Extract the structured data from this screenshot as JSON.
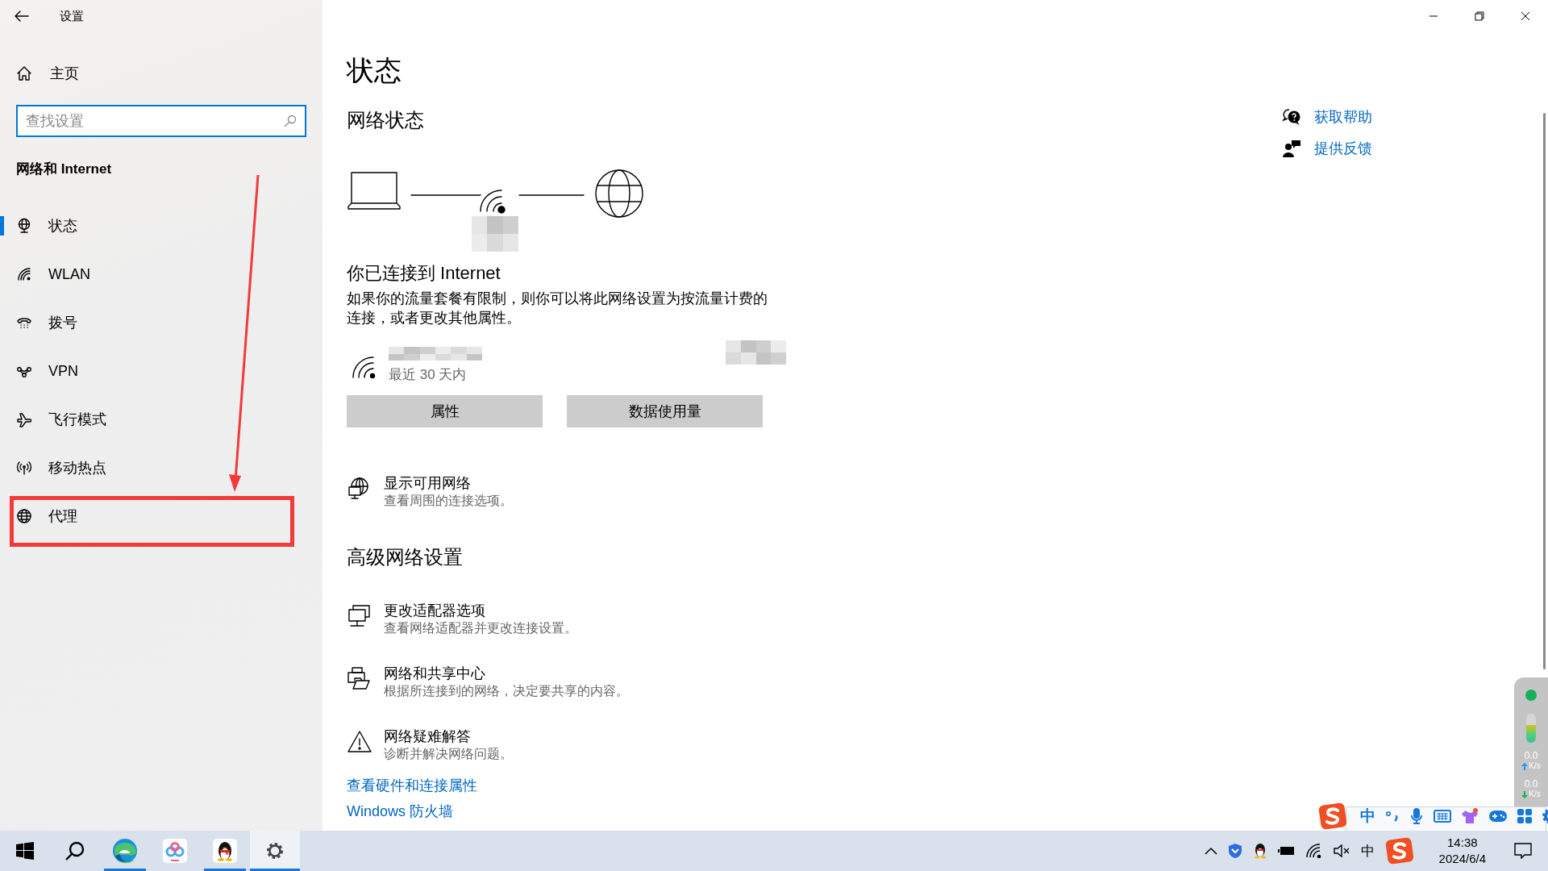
{
  "window": {
    "title": "设置"
  },
  "sidebar": {
    "home": "主页",
    "search": {
      "placeholder": "查找设置",
      "focused": true
    },
    "section": "网络和 Internet",
    "items": [
      {
        "kind": "status",
        "label": "状态",
        "selected": true,
        "highlighted": false
      },
      {
        "kind": "wlan",
        "label": "WLAN",
        "selected": false,
        "highlighted": false
      },
      {
        "kind": "dialup",
        "label": "拨号",
        "selected": false,
        "highlighted": false
      },
      {
        "kind": "vpn",
        "label": "VPN",
        "selected": false,
        "highlighted": false
      },
      {
        "kind": "airplane",
        "label": "飞行模式",
        "selected": false,
        "highlighted": false
      },
      {
        "kind": "hotspot",
        "label": "移动热点",
        "selected": false,
        "highlighted": false
      },
      {
        "kind": "proxy",
        "label": "代理",
        "selected": false,
        "highlighted": true
      }
    ]
  },
  "main": {
    "title": "状态",
    "network_status": {
      "heading": "网络状态",
      "connected_title": "你已连接到 Internet",
      "description": "如果你的流量套餐有限制，则你可以将此网络设置为按流量计费的连接，或者更改其他属性。",
      "usage_period": "最近 30 天内",
      "buttons": [
        "属性",
        "数据使用量"
      ]
    },
    "show_networks": {
      "kind": "networks",
      "title": "显示可用网络",
      "subtitle": "查看周围的连接选项。"
    },
    "advanced": {
      "heading": "高级网络设置",
      "items": [
        {
          "kind": "adapter",
          "title": "更改适配器选项",
          "subtitle": "查看网络适配器并更改连接设置。"
        },
        {
          "kind": "sharing",
          "title": "网络和共享中心",
          "subtitle": "根据所连接到的网络，决定要共享的内容。"
        },
        {
          "kind": "troubleshoot",
          "title": "网络疑难解答",
          "subtitle": "诊断并解决网络问题。"
        }
      ]
    },
    "links": [
      "查看硬件和连接属性",
      "Windows 防火墙"
    ]
  },
  "help_links": [
    {
      "kind": "help",
      "label": "获取帮助"
    },
    {
      "kind": "feedback",
      "label": "提供反馈"
    }
  ],
  "speed_widget": {
    "level": 0.6,
    "upload": {
      "value": "0.0",
      "unit": "K/s"
    },
    "download": {
      "value": "0.0",
      "unit": "K/s"
    }
  },
  "ime_toolbar": {
    "mode": "中"
  },
  "taskbar": {
    "apps": [
      {
        "kind": "start",
        "running": false,
        "selected": false
      },
      {
        "kind": "search",
        "running": false,
        "selected": false
      },
      {
        "kind": "edge",
        "running": true,
        "selected": false
      },
      {
        "kind": "netdisk",
        "running": false,
        "selected": false
      },
      {
        "kind": "qq",
        "running": true,
        "selected": false
      },
      {
        "kind": "settings",
        "running": true,
        "selected": true
      }
    ],
    "tray": {
      "input_mode": "中",
      "time": "14:38",
      "date": "2024/6/4"
    }
  }
}
